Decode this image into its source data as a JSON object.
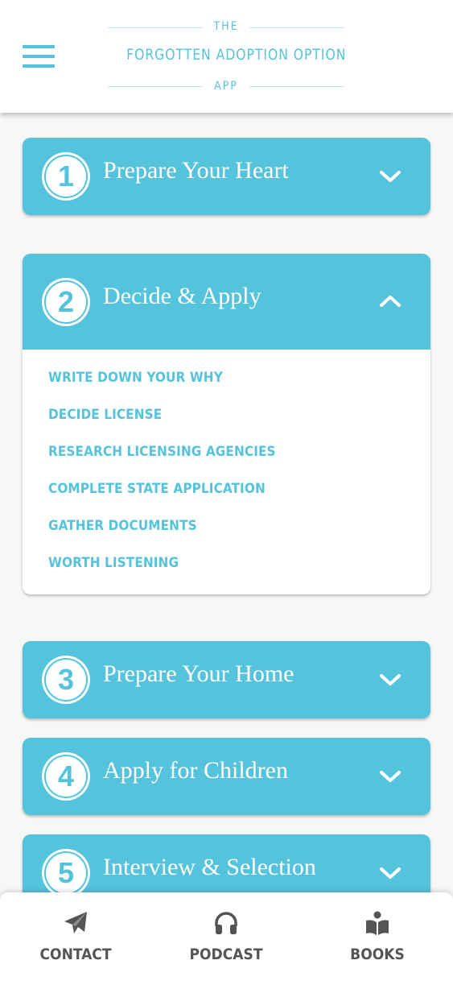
{
  "header": {
    "logo_top": "THE",
    "logo_main": "FORGOTTEN ADOPTION OPTION",
    "logo_bottom": "APP"
  },
  "sections": [
    {
      "number": "1",
      "title": "Prepare Your Heart",
      "expanded": false
    },
    {
      "number": "2",
      "title": "Decide & Apply",
      "expanded": true,
      "items": [
        "WRITE DOWN YOUR WHY",
        "DECIDE LICENSE",
        "RESEARCH LICENSING AGENCIES",
        "COMPLETE STATE APPLICATION",
        "GATHER DOCUMENTS",
        "WORTH LISTENING"
      ]
    },
    {
      "number": "3",
      "title": "Prepare Your Home",
      "expanded": false
    },
    {
      "number": "4",
      "title": "Apply for Children",
      "expanded": false
    },
    {
      "number": "5",
      "title": "Interview & Selection",
      "expanded": false
    }
  ],
  "bottom_nav": [
    {
      "label": "CONTACT",
      "icon": "paper-plane-icon"
    },
    {
      "label": "PODCAST",
      "icon": "headphones-icon"
    },
    {
      "label": "BOOKS",
      "icon": "reader-book-icon"
    }
  ],
  "colors": {
    "accent": "#55c3dc",
    "nav_text": "#555555",
    "background": "#f7f7f7"
  }
}
